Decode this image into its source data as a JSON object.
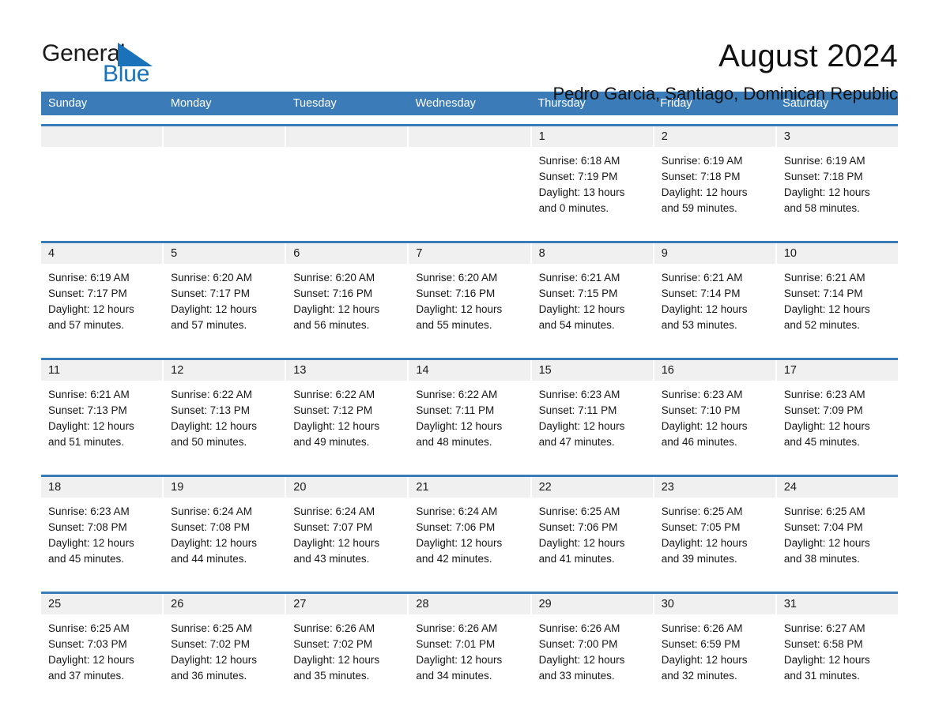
{
  "brand": {
    "name_part1": "General",
    "name_part2": "Blue",
    "triangle_color": "#1a72ba",
    "accent_color": "#3b7cb8"
  },
  "header": {
    "title": "August 2024",
    "subtitle": "Pedro Garcia, Santiago, Dominican Republic"
  },
  "weekday_headers": [
    "Sunday",
    "Monday",
    "Tuesday",
    "Wednesday",
    "Thursday",
    "Friday",
    "Saturday"
  ],
  "weeks": [
    {
      "days": [
        {
          "num": "",
          "sunrise": "",
          "sunset": "",
          "daylight_line1": "",
          "daylight_line2": ""
        },
        {
          "num": "",
          "sunrise": "",
          "sunset": "",
          "daylight_line1": "",
          "daylight_line2": ""
        },
        {
          "num": "",
          "sunrise": "",
          "sunset": "",
          "daylight_line1": "",
          "daylight_line2": ""
        },
        {
          "num": "",
          "sunrise": "",
          "sunset": "",
          "daylight_line1": "",
          "daylight_line2": ""
        },
        {
          "num": "1",
          "sunrise": "Sunrise: 6:18 AM",
          "sunset": "Sunset: 7:19 PM",
          "daylight_line1": "Daylight: 13 hours",
          "daylight_line2": "and 0 minutes."
        },
        {
          "num": "2",
          "sunrise": "Sunrise: 6:19 AM",
          "sunset": "Sunset: 7:18 PM",
          "daylight_line1": "Daylight: 12 hours",
          "daylight_line2": "and 59 minutes."
        },
        {
          "num": "3",
          "sunrise": "Sunrise: 6:19 AM",
          "sunset": "Sunset: 7:18 PM",
          "daylight_line1": "Daylight: 12 hours",
          "daylight_line2": "and 58 minutes."
        }
      ]
    },
    {
      "days": [
        {
          "num": "4",
          "sunrise": "Sunrise: 6:19 AM",
          "sunset": "Sunset: 7:17 PM",
          "daylight_line1": "Daylight: 12 hours",
          "daylight_line2": "and 57 minutes."
        },
        {
          "num": "5",
          "sunrise": "Sunrise: 6:20 AM",
          "sunset": "Sunset: 7:17 PM",
          "daylight_line1": "Daylight: 12 hours",
          "daylight_line2": "and 57 minutes."
        },
        {
          "num": "6",
          "sunrise": "Sunrise: 6:20 AM",
          "sunset": "Sunset: 7:16 PM",
          "daylight_line1": "Daylight: 12 hours",
          "daylight_line2": "and 56 minutes."
        },
        {
          "num": "7",
          "sunrise": "Sunrise: 6:20 AM",
          "sunset": "Sunset: 7:16 PM",
          "daylight_line1": "Daylight: 12 hours",
          "daylight_line2": "and 55 minutes."
        },
        {
          "num": "8",
          "sunrise": "Sunrise: 6:21 AM",
          "sunset": "Sunset: 7:15 PM",
          "daylight_line1": "Daylight: 12 hours",
          "daylight_line2": "and 54 minutes."
        },
        {
          "num": "9",
          "sunrise": "Sunrise: 6:21 AM",
          "sunset": "Sunset: 7:14 PM",
          "daylight_line1": "Daylight: 12 hours",
          "daylight_line2": "and 53 minutes."
        },
        {
          "num": "10",
          "sunrise": "Sunrise: 6:21 AM",
          "sunset": "Sunset: 7:14 PM",
          "daylight_line1": "Daylight: 12 hours",
          "daylight_line2": "and 52 minutes."
        }
      ]
    },
    {
      "days": [
        {
          "num": "11",
          "sunrise": "Sunrise: 6:21 AM",
          "sunset": "Sunset: 7:13 PM",
          "daylight_line1": "Daylight: 12 hours",
          "daylight_line2": "and 51 minutes."
        },
        {
          "num": "12",
          "sunrise": "Sunrise: 6:22 AM",
          "sunset": "Sunset: 7:13 PM",
          "daylight_line1": "Daylight: 12 hours",
          "daylight_line2": "and 50 minutes."
        },
        {
          "num": "13",
          "sunrise": "Sunrise: 6:22 AM",
          "sunset": "Sunset: 7:12 PM",
          "daylight_line1": "Daylight: 12 hours",
          "daylight_line2": "and 49 minutes."
        },
        {
          "num": "14",
          "sunrise": "Sunrise: 6:22 AM",
          "sunset": "Sunset: 7:11 PM",
          "daylight_line1": "Daylight: 12 hours",
          "daylight_line2": "and 48 minutes."
        },
        {
          "num": "15",
          "sunrise": "Sunrise: 6:23 AM",
          "sunset": "Sunset: 7:11 PM",
          "daylight_line1": "Daylight: 12 hours",
          "daylight_line2": "and 47 minutes."
        },
        {
          "num": "16",
          "sunrise": "Sunrise: 6:23 AM",
          "sunset": "Sunset: 7:10 PM",
          "daylight_line1": "Daylight: 12 hours",
          "daylight_line2": "and 46 minutes."
        },
        {
          "num": "17",
          "sunrise": "Sunrise: 6:23 AM",
          "sunset": "Sunset: 7:09 PM",
          "daylight_line1": "Daylight: 12 hours",
          "daylight_line2": "and 45 minutes."
        }
      ]
    },
    {
      "days": [
        {
          "num": "18",
          "sunrise": "Sunrise: 6:23 AM",
          "sunset": "Sunset: 7:08 PM",
          "daylight_line1": "Daylight: 12 hours",
          "daylight_line2": "and 45 minutes."
        },
        {
          "num": "19",
          "sunrise": "Sunrise: 6:24 AM",
          "sunset": "Sunset: 7:08 PM",
          "daylight_line1": "Daylight: 12 hours",
          "daylight_line2": "and 44 minutes."
        },
        {
          "num": "20",
          "sunrise": "Sunrise: 6:24 AM",
          "sunset": "Sunset: 7:07 PM",
          "daylight_line1": "Daylight: 12 hours",
          "daylight_line2": "and 43 minutes."
        },
        {
          "num": "21",
          "sunrise": "Sunrise: 6:24 AM",
          "sunset": "Sunset: 7:06 PM",
          "daylight_line1": "Daylight: 12 hours",
          "daylight_line2": "and 42 minutes."
        },
        {
          "num": "22",
          "sunrise": "Sunrise: 6:25 AM",
          "sunset": "Sunset: 7:06 PM",
          "daylight_line1": "Daylight: 12 hours",
          "daylight_line2": "and 41 minutes."
        },
        {
          "num": "23",
          "sunrise": "Sunrise: 6:25 AM",
          "sunset": "Sunset: 7:05 PM",
          "daylight_line1": "Daylight: 12 hours",
          "daylight_line2": "and 39 minutes."
        },
        {
          "num": "24",
          "sunrise": "Sunrise: 6:25 AM",
          "sunset": "Sunset: 7:04 PM",
          "daylight_line1": "Daylight: 12 hours",
          "daylight_line2": "and 38 minutes."
        }
      ]
    },
    {
      "days": [
        {
          "num": "25",
          "sunrise": "Sunrise: 6:25 AM",
          "sunset": "Sunset: 7:03 PM",
          "daylight_line1": "Daylight: 12 hours",
          "daylight_line2": "and 37 minutes."
        },
        {
          "num": "26",
          "sunrise": "Sunrise: 6:25 AM",
          "sunset": "Sunset: 7:02 PM",
          "daylight_line1": "Daylight: 12 hours",
          "daylight_line2": "and 36 minutes."
        },
        {
          "num": "27",
          "sunrise": "Sunrise: 6:26 AM",
          "sunset": "Sunset: 7:02 PM",
          "daylight_line1": "Daylight: 12 hours",
          "daylight_line2": "and 35 minutes."
        },
        {
          "num": "28",
          "sunrise": "Sunrise: 6:26 AM",
          "sunset": "Sunset: 7:01 PM",
          "daylight_line1": "Daylight: 12 hours",
          "daylight_line2": "and 34 minutes."
        },
        {
          "num": "29",
          "sunrise": "Sunrise: 6:26 AM",
          "sunset": "Sunset: 7:00 PM",
          "daylight_line1": "Daylight: 12 hours",
          "daylight_line2": "and 33 minutes."
        },
        {
          "num": "30",
          "sunrise": "Sunrise: 6:26 AM",
          "sunset": "Sunset: 6:59 PM",
          "daylight_line1": "Daylight: 12 hours",
          "daylight_line2": "and 32 minutes."
        },
        {
          "num": "31",
          "sunrise": "Sunrise: 6:27 AM",
          "sunset": "Sunset: 6:58 PM",
          "daylight_line1": "Daylight: 12 hours",
          "daylight_line2": "and 31 minutes."
        }
      ]
    }
  ]
}
